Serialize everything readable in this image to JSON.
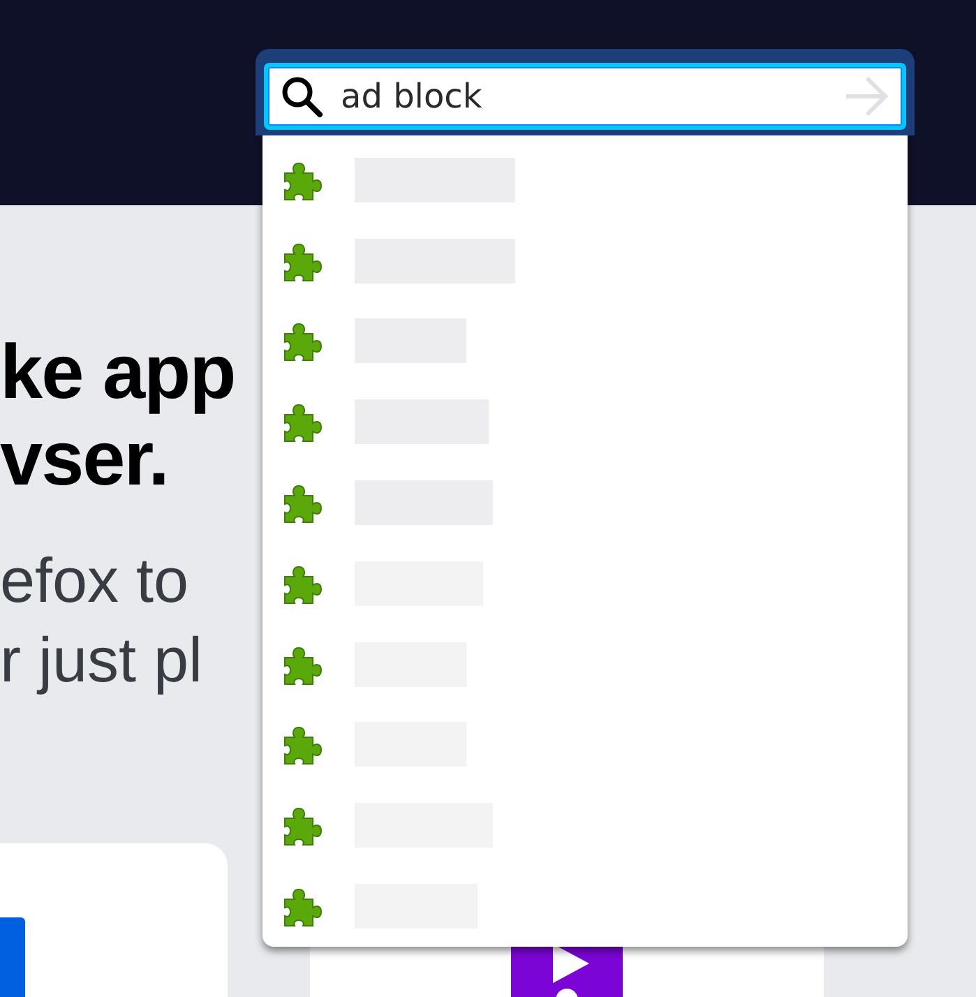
{
  "search": {
    "value": "ad block"
  },
  "results": [
    {
      "kind": "loading"
    },
    {
      "kind": "loading"
    },
    {
      "kind": "loading"
    },
    {
      "kind": "loading"
    },
    {
      "kind": "loading"
    },
    {
      "kind": "loading"
    },
    {
      "kind": "loading"
    },
    {
      "kind": "loading"
    },
    {
      "kind": "loading"
    },
    {
      "kind": "loading"
    }
  ],
  "hero": {
    "heading_lines": [
      "ke app",
      "vser."
    ],
    "body_lines": [
      "efox to",
      "r just pl"
    ]
  }
}
